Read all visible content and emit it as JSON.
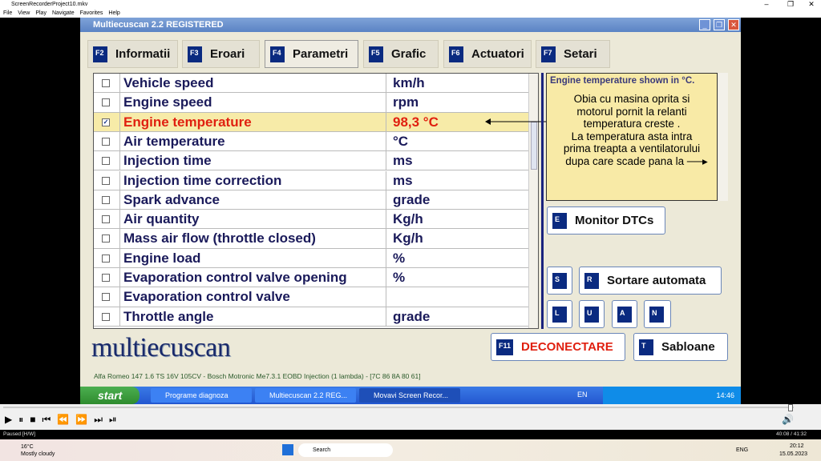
{
  "player": {
    "title": "ScreenRecorderProject10.mkv",
    "menu": [
      "File",
      "View",
      "Play",
      "Navigate",
      "Favorites",
      "Help"
    ],
    "status": "Paused [H/W]",
    "time": "40:08 / 41:32",
    "progress_percent": 96.6
  },
  "app": {
    "title": "Multiecuscan 2.2 REGISTERED",
    "tabs": [
      {
        "key": "F2",
        "label": "Informatii"
      },
      {
        "key": "F3",
        "label": "Eroari"
      },
      {
        "key": "F4",
        "label": "Parametri",
        "active": true
      },
      {
        "key": "F5",
        "label": "Grafic"
      },
      {
        "key": "F6",
        "label": "Actuatori"
      },
      {
        "key": "F7",
        "label": "Setari"
      }
    ],
    "params": [
      {
        "name": "Vehicle speed",
        "unit": "km/h",
        "checked": false
      },
      {
        "name": "Engine speed",
        "unit": "rpm",
        "checked": false
      },
      {
        "name": "Engine temperature",
        "unit": "98,3 °C",
        "checked": true
      },
      {
        "name": "Air temperature",
        "unit": "°C",
        "checked": false
      },
      {
        "name": "Injection time",
        "unit": "ms",
        "checked": false
      },
      {
        "name": "Injection time correction",
        "unit": "ms",
        "checked": false
      },
      {
        "name": "Spark advance",
        "unit": "grade",
        "checked": false
      },
      {
        "name": "Air quantity",
        "unit": "Kg/h",
        "checked": false
      },
      {
        "name": "Mass air flow (throttle closed)",
        "unit": "Kg/h",
        "checked": false
      },
      {
        "name": "Engine load",
        "unit": "%",
        "checked": false
      },
      {
        "name": "Evaporation control valve opening",
        "unit": "%",
        "checked": false
      },
      {
        "name": "Evaporation control valve",
        "unit": "",
        "checked": false
      },
      {
        "name": "Throttle angle",
        "unit": "grade",
        "checked": false
      }
    ],
    "note": {
      "header": "Engine temperature shown in °C.",
      "lines": [
        "Obia cu masina oprita si",
        "motorul pornit la relanti",
        "temperatura creste .",
        "La temperatura asta intra",
        "prima treapta a ventilatorului",
        "dupa care scade pana la"
      ]
    },
    "buttons": {
      "monitor": {
        "key": "E",
        "label": "Monitor DTCs"
      },
      "s": "S",
      "sort": {
        "key": "R",
        "label": "Sortare automata"
      },
      "small": [
        "L",
        "U",
        "A",
        "N"
      ],
      "disconnect": {
        "key": "F11",
        "label": "DECONECTARE"
      },
      "templates": {
        "key": "T",
        "label": "Sabloane"
      }
    },
    "logo": "multiecuscan",
    "status": "Alfa Romeo 147 1.6 TS 16V 105CV - Bosch Motronic Me7.3.1 EOBD Injection (1 lambda) - [7C 86 8A 80 61]"
  },
  "xp": {
    "start": "start",
    "tasks": [
      "Programe diagnoza",
      "Multiecuscan 2.2 REG...",
      "Movavi Screen Recor..."
    ],
    "lang": "EN",
    "clock": "14:46"
  },
  "win": {
    "weather_temp": "16°C",
    "weather_desc": "Mostly cloudy",
    "search": "Search",
    "lang": "ENG",
    "time": "20:12",
    "date": "15.05.2023"
  },
  "colors": {
    "selected_row": "#f7eba8",
    "selected_text": "#e02010",
    "key_badge": "#0a2a80",
    "note_bg": "#f8eaa6"
  }
}
